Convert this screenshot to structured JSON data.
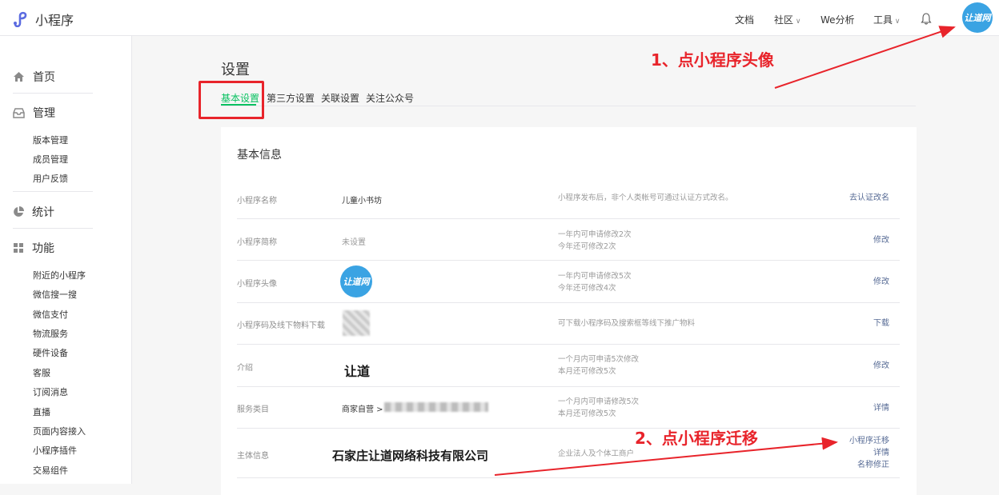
{
  "header": {
    "app_title": "小程序",
    "nav": [
      "文档",
      "社区",
      "We分析",
      "工具"
    ],
    "avatar_text": "让道网"
  },
  "sidebar": {
    "sections": [
      {
        "label": "首页",
        "icon": "home-icon"
      },
      {
        "label": "管理",
        "icon": "inbox-icon",
        "items": [
          "版本管理",
          "成员管理",
          "用户反馈"
        ]
      },
      {
        "label": "统计",
        "icon": "pie-chart-icon"
      },
      {
        "label": "功能",
        "icon": "grid-icon",
        "items": [
          "附近的小程序",
          "微信搜一搜",
          "微信支付",
          "物流服务",
          "硬件设备",
          "客服",
          "订阅消息",
          "直播",
          "页面内容接入",
          "小程序插件",
          "交易组件"
        ]
      }
    ]
  },
  "page": {
    "title": "设置",
    "tabs": [
      "基本设置",
      "第三方设置",
      "关联设置",
      "关注公众号"
    ],
    "card_title": "基本信息"
  },
  "rows": [
    {
      "label": "小程序名称",
      "value": "儿童小书坊",
      "desc": [
        "小程序发布后，非个人类帐号可通过认证方式改名。"
      ],
      "actions": [
        "去认证改名"
      ]
    },
    {
      "label": "小程序简称",
      "value": "未设置",
      "desc": [
        "一年内可申请修改2次",
        "今年还可修改2次"
      ],
      "actions": [
        "修改"
      ]
    },
    {
      "label": "小程序头像",
      "value": "",
      "desc": [
        "一年内可申请修改5次",
        "今年还可修改4次"
      ],
      "actions": [
        "修改"
      ]
    },
    {
      "label": "小程序码及线下物料下载",
      "value": "",
      "desc": [
        "可下载小程序码及搜索框等线下推广物料"
      ],
      "actions": [
        "下载"
      ]
    },
    {
      "label": "介绍",
      "value": "让道",
      "desc": [
        "一个月内可申请5次修改",
        "本月还可修改5次"
      ],
      "actions": [
        "修改"
      ]
    },
    {
      "label": "服务类目",
      "value": "商家自营 >",
      "desc": [
        "一个月内可申请修改5次",
        "本月还可修改5次"
      ],
      "actions": [
        "详情"
      ]
    },
    {
      "label": "主体信息",
      "value": "石家庄让道网络科技有限公司",
      "desc": [
        "企业法人及个体工商户"
      ],
      "actions": [
        "小程序迁移",
        "详情",
        "名称修正"
      ]
    }
  ],
  "annotations": {
    "step1": "1、点小程序头像",
    "step2": "2、点小程序迁移",
    "color": "#e8242b"
  }
}
